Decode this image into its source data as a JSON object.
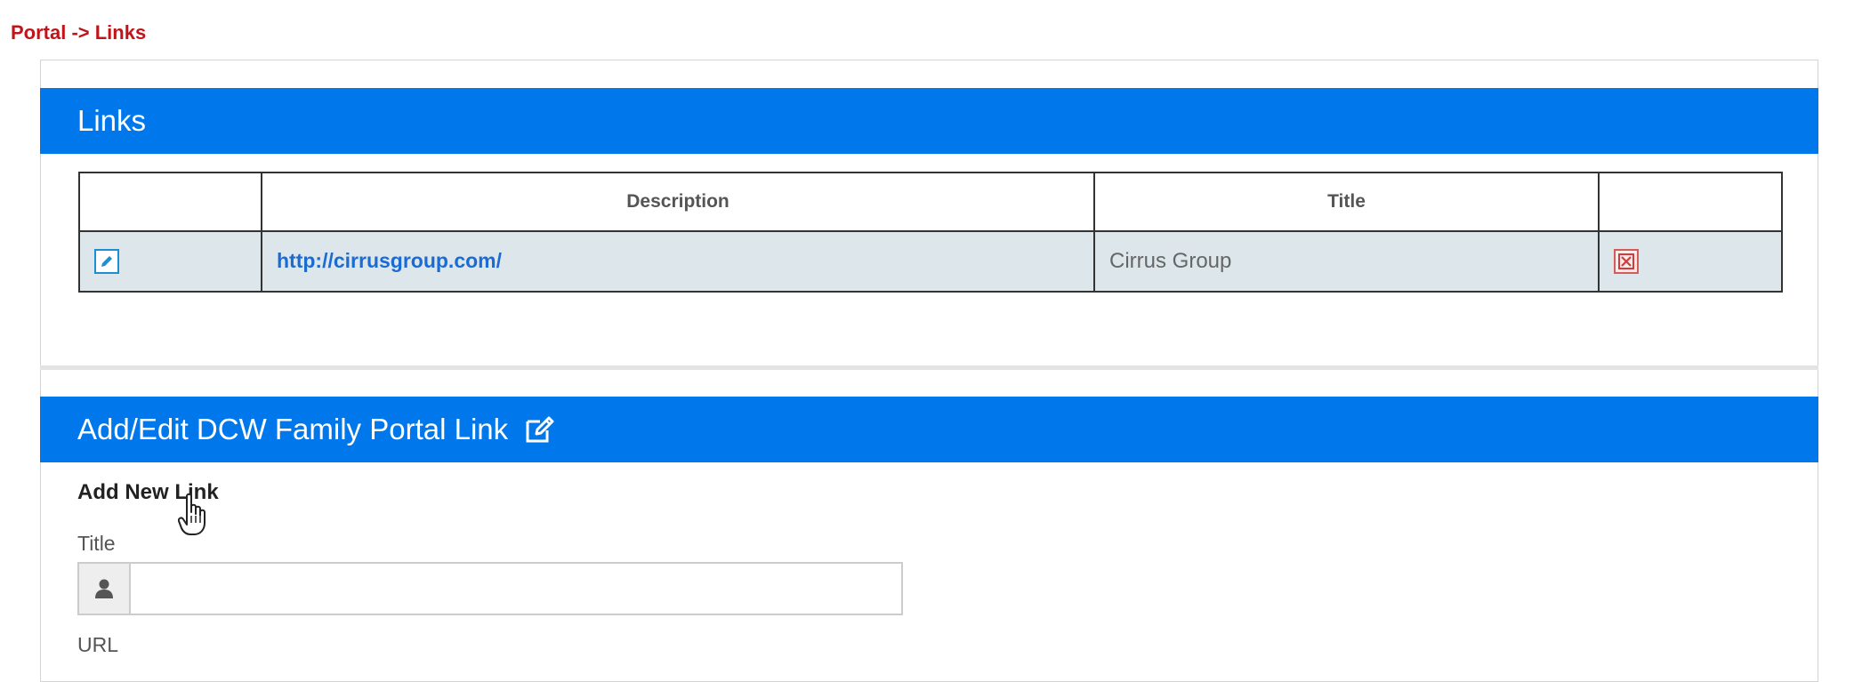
{
  "breadcrumb": {
    "text": "Portal -> Links"
  },
  "links_section": {
    "title": "Links",
    "table": {
      "headers": [
        "",
        "Description",
        "Title",
        ""
      ],
      "rows": [
        {
          "description": "http://cirrusgroup.com/",
          "title": "Cirrus Group"
        }
      ]
    }
  },
  "edit_section": {
    "title": "Add/Edit DCW Family Portal Link",
    "subheading": "Add New Link",
    "fields": {
      "title_label": "Title",
      "title_value": "",
      "url_label": "URL"
    }
  },
  "colors": {
    "header_blue": "#0078ec",
    "breadcrumb_red": "#c0141a",
    "row_bg": "#dde7eb",
    "link_blue": "#1a6bd4"
  },
  "icons": {
    "edit_row": "pencil-square-icon",
    "delete_row": "close-box-icon",
    "edit_section": "pencil-square-outline-icon",
    "title_field": "user-icon"
  }
}
